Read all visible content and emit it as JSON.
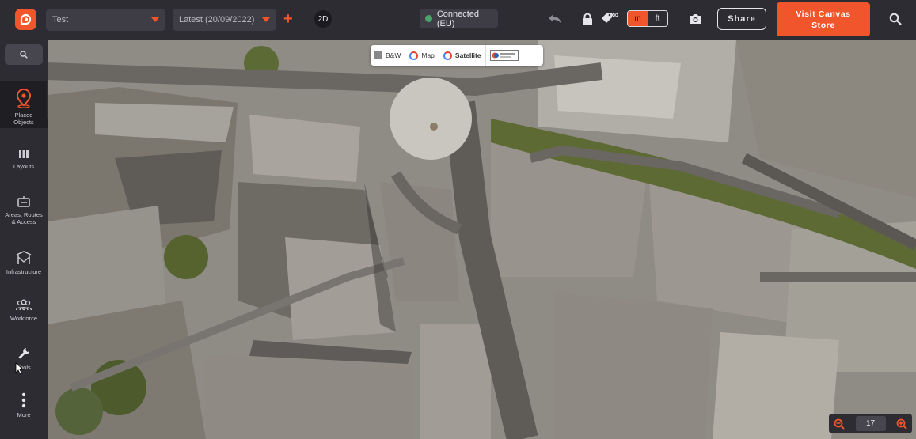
{
  "topbar": {
    "project_select": "Test",
    "version_select": "Latest (20/09/2022)",
    "view_mode_button": "2D",
    "connection_status": "Connected (EU)",
    "unit_toggle": {
      "options": [
        "m",
        "ft"
      ],
      "selected": "m"
    },
    "share_label": "Share",
    "visit_store_label": "Visit Canvas\nStore"
  },
  "sidebar": {
    "items": [
      {
        "label": "Placed\nObjects",
        "icon": "map-pin-icon",
        "active": true
      },
      {
        "label": "Layouts",
        "icon": "bars-icon"
      },
      {
        "label": "Areas, Routes\n& Access",
        "icon": "sign-icon"
      },
      {
        "label": "Infrastructure",
        "icon": "tent-icon"
      },
      {
        "label": "Workforce",
        "icon": "people-icon"
      },
      {
        "label": "Tools",
        "icon": "wrench-icon"
      },
      {
        "label": "More",
        "icon": "more-vertical-icon"
      }
    ]
  },
  "map": {
    "layer_options": [
      {
        "label": "B&W",
        "icon": "bw-thumb-icon"
      },
      {
        "label": "Map",
        "icon": "google-icon"
      },
      {
        "label": "Satellite",
        "icon": "google-icon",
        "selected": true
      },
      {
        "label": "",
        "icon": "ordnance-survey-logo"
      }
    ],
    "zoom_level": "17"
  },
  "colors": {
    "accent": "#f0552b",
    "chrome": "#2e2c33",
    "status_ok": "#49a36b"
  }
}
